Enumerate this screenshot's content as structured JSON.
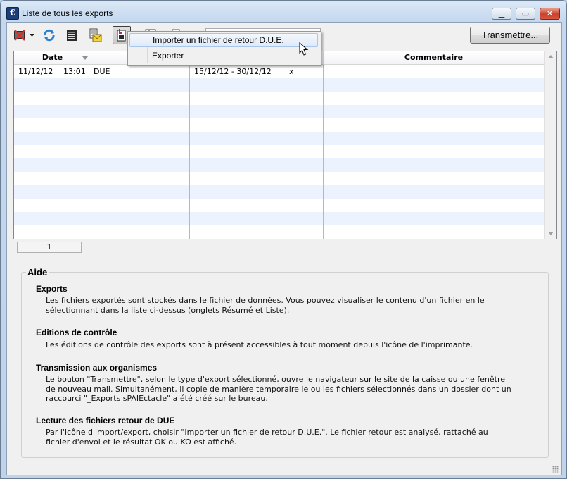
{
  "window": {
    "title": "Liste de tous les exports",
    "app_icon_glyph": "€"
  },
  "toolbar": {
    "transmit_label": "Transmettre...",
    "icons": [
      "export-tools-icon",
      "dropdown-arrow-icon",
      "refresh-icon",
      "print-icon",
      "mail-icon",
      "import-export-icon",
      "table-icon",
      "document-icon"
    ]
  },
  "grid": {
    "columns": [
      "Date",
      "",
      "",
      "",
      "",
      "Commentaire"
    ],
    "rows": [
      {
        "date": "11/12/12",
        "time": "13:01",
        "type": "DUE",
        "period": "15/12/12 - 30/12/12",
        "flag": "x",
        "extra": "",
        "comment": ""
      }
    ],
    "empty_rows": 12,
    "count": "1"
  },
  "menu": {
    "items": [
      {
        "label": "Importer un fichier de retour D.U.E.",
        "highlighted": true
      },
      {
        "label": "Exporter",
        "highlighted": false
      }
    ]
  },
  "help": {
    "title": "Aide",
    "sections": [
      {
        "heading": "Exports",
        "lines": [
          "Les fichiers exportés sont stockés dans le fichier de données. Vous pouvez visualiser le contenu d'un fichier en le",
          "sélectionnant dans la liste ci-dessus (onglets Résumé et Liste)."
        ]
      },
      {
        "heading": "Editions de contrôle",
        "lines": [
          "Les éditions de contrôle des exports sont à présent accessibles à tout moment depuis l'icône de l'imprimante."
        ]
      },
      {
        "heading": "Transmission aux organismes",
        "lines": [
          "Le bouton \"Transmettre\", selon le type d'export sélectionné, ouvre le navigateur sur le site de la caisse ou une fenêtre",
          "de nouveau mail. Simultanément, il copie de manière temporaire le ou les fichiers sélectionnés dans un dossier dont un",
          "raccourci \"_Exports sPAIEctacle\" a été créé sur le bureau."
        ]
      },
      {
        "heading": "Lecture des fichiers retour de DUE",
        "lines": [
          "Par l'icône d'import/export, choisir \"Importer un fichier de retour D.U.E.\". Le fichier retour est analysé, rattaché au",
          "fichier d'envoi et le résultat OK ou KO est affiché."
        ]
      }
    ]
  }
}
